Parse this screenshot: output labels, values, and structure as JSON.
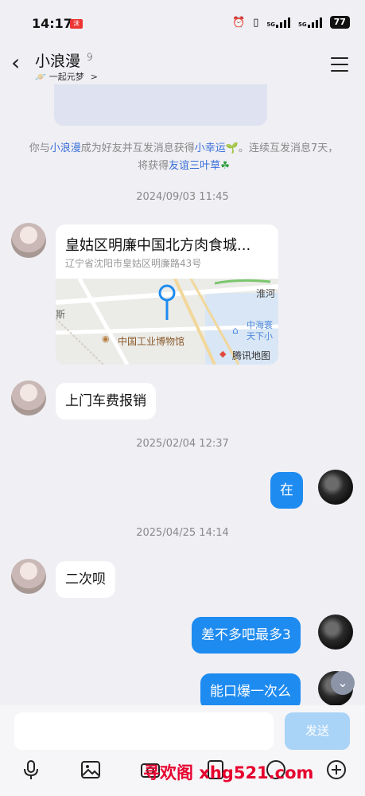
{
  "status_bar": {
    "time": "14:17",
    "app_badge": "沫",
    "network_1": "5G",
    "network_2": "5G",
    "battery": "77"
  },
  "header": {
    "contact_name": "小浪漫",
    "subtitle": "一起元梦",
    "subtitle_chevron": ">"
  },
  "system_notice": {
    "part1": "你与",
    "name": "小浪漫",
    "part2": "成为好友并互发消息获得",
    "badge1": "小幸运",
    "part3": "。连续互发消息7天，将获得",
    "badge2": "友谊三叶草"
  },
  "messages": [
    {
      "timestamp": "2024/09/03 11:45"
    },
    {
      "type": "location",
      "title": "皇姑区明廉中国北方肉食城...",
      "address": "辽宁省沈阳市皇姑区明廉路43号",
      "map_labels": {
        "river": "淮河",
        "poi_1": "中海寰",
        "poi_2": "天下小",
        "museum": "中国工业博物馆",
        "left_edge": "斯",
        "brand": "腾讯地图"
      }
    },
    {
      "type": "text",
      "side": "left",
      "text": "上门车费报销"
    },
    {
      "timestamp": "2025/02/04 12:37"
    },
    {
      "type": "text",
      "side": "right",
      "text": "在"
    },
    {
      "timestamp": "2025/04/25 14:14"
    },
    {
      "type": "text",
      "side": "left",
      "text": "二次呗"
    },
    {
      "type": "text",
      "side": "right",
      "text": "差不多吧最多3"
    },
    {
      "type": "text",
      "side": "right",
      "text": "能口爆一次么"
    }
  ],
  "input": {
    "placeholder": "",
    "send_label": "发送"
  },
  "toolbar_icons": [
    "microphone-icon",
    "image-icon",
    "camera-icon",
    "red-packet-icon",
    "emoji-icon",
    "plus-icon"
  ],
  "watermark": "寻欢阁 xhg521.com",
  "colors": {
    "accent": "#1e8bf0",
    "background": "#efeff4",
    "send_disabled": "#a9d3f7"
  }
}
